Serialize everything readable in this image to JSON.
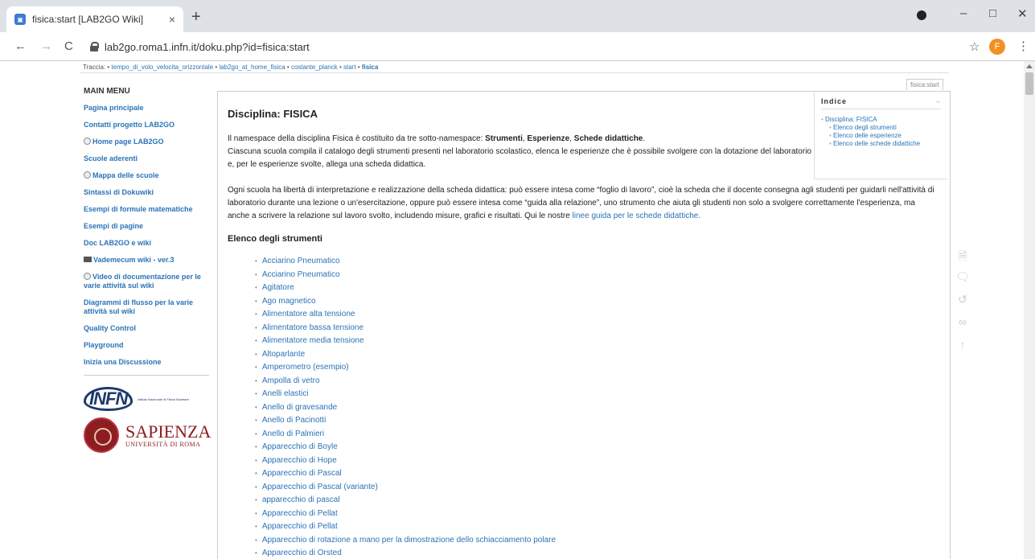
{
  "browser": {
    "tab_title": "fisica:start [LAB2GO Wiki]",
    "tab_close": "×",
    "new_tab": "+",
    "url": "lab2go.roma1.infn.it/doku.php?id=fisica:start",
    "profile_initial": "F",
    "back": "←",
    "forward": "→",
    "reload": "C",
    "star": "☆",
    "menu": "⋮",
    "minimize": "–",
    "maximize": "□",
    "close": "✕"
  },
  "breadcrumb": {
    "label": "Traccia:",
    "items": [
      "tempo_di_volo_velocita_orizzontale",
      "lab2go_at_home_fisica",
      "costante_planck",
      "start"
    ],
    "current": "fisica"
  },
  "sidebar": {
    "title": "MAIN MENU",
    "items": [
      {
        "label": "Pagina principale"
      },
      {
        "label": "Contatti progetto LAB2GO"
      },
      {
        "label": "Home page LAB2GO"
      },
      {
        "label": "Scuole aderenti"
      },
      {
        "label": "Mappa delle scuole"
      },
      {
        "label": "Sintassi di Dokuwiki"
      },
      {
        "label": "Esempi di formule matematiche"
      },
      {
        "label": "Esempi di pagine"
      },
      {
        "label": "Doc LAB2GO e wiki"
      },
      {
        "label": "Vademecum wiki - ver.3"
      },
      {
        "label": "Video di documentazione per le varie attività sul wiki"
      },
      {
        "label": "Diagrammi di flusso per la varie attività sul wiki"
      },
      {
        "label": "Quality Control"
      },
      {
        "label": "Playground"
      },
      {
        "label": "Inizia una Discussione"
      }
    ],
    "infn_logo": "INFN",
    "infn_sub": "Istituto Nazionale di Fisica Nucleare",
    "sapienza_main": "SAPIENZA",
    "sapienza_sub": "UNIVERSITÀ DI ROMA"
  },
  "page": {
    "pagename": "fisica:start",
    "title": "Disciplina: FISICA",
    "intro_1": "Il namespace della disciplina Fisica è costituito da tre sotto-namespace: ",
    "strumenti": "Strumenti",
    "sep1": ", ",
    "esperienze": "Esperienze",
    "sep2": ", ",
    "schede": "Schede didattiche",
    "intro_end": ".",
    "intro_2": "Ciascuna scuola compila il catalogo degli strumenti presenti nel laboratorio scolastico, elenca le esperienze che è possibile svolgere con la dotazione del laboratorio e, per le esperienze svolte, allega una scheda didattica.",
    "para_2": "Ogni scuola ha libertà di interpretazione e realizzazione della scheda didattica: può essere intesa come “foglio di lavoro”, cioè la scheda che il docente consegna agli studenti per guidarli nell'attività di laboratorio durante una lezione o un'esercitazione, oppure può essere intesa come “guida alla relazione”, uno strumento che aiuta gli studenti non solo a svolgere correttamente l'esperienza, ma anche a scrivere la relazione sul lavoro svolto, includendo misure, grafici e risultati. Qui le nostre ",
    "para_2_link": "linee guida per le schede didattiche",
    "para_2_end": ".",
    "section_title": "Elenco degli strumenti",
    "tools": [
      "Acciarino Pneumatico",
      "Acciarino Pneumatico",
      "Agitatore",
      "Ago magnetico",
      "Alimentatore alta tensione",
      "Alimentatore bassa tensione",
      "Alimentatore media tensione",
      "Altoparlante",
      "Amperometro (esempio)",
      "Ampolla di vetro",
      "Anelli elastici",
      "Anello di gravesande",
      "Anello di Pacinotti",
      "Anello di Palmieri",
      "Apparecchio di Boyle",
      "Apparecchio di Hope",
      "Apparecchio di Pascal",
      "Apparecchio di Pascal (variante)",
      "apparecchio di pascal",
      "Apparecchio di Pellat",
      "Apparecchio di Pellat",
      "Apparecchio di rotazione a mano per la dimostrazione dello schiacciamento polare",
      "Apparecchio di Orsted"
    ]
  },
  "toc": {
    "title": "Indice",
    "toggle": "–",
    "items": [
      {
        "label": "Disciplina: FISICA",
        "level": 1
      },
      {
        "label": "Elenco degli strumenti",
        "level": 2
      },
      {
        "label": "Elenco delle esperienze",
        "level": 2
      },
      {
        "label": "Elenco delle schede didattiche",
        "level": 2
      }
    ]
  },
  "page_tools": [
    {
      "icon": "edit-page-icon",
      "glyph": "🗎"
    },
    {
      "icon": "discussion-icon",
      "glyph": "🗨"
    },
    {
      "icon": "revisions-icon",
      "glyph": "↺"
    },
    {
      "icon": "backlinks-icon",
      "glyph": "∞"
    },
    {
      "icon": "back-to-top-icon",
      "glyph": "↑"
    }
  ]
}
